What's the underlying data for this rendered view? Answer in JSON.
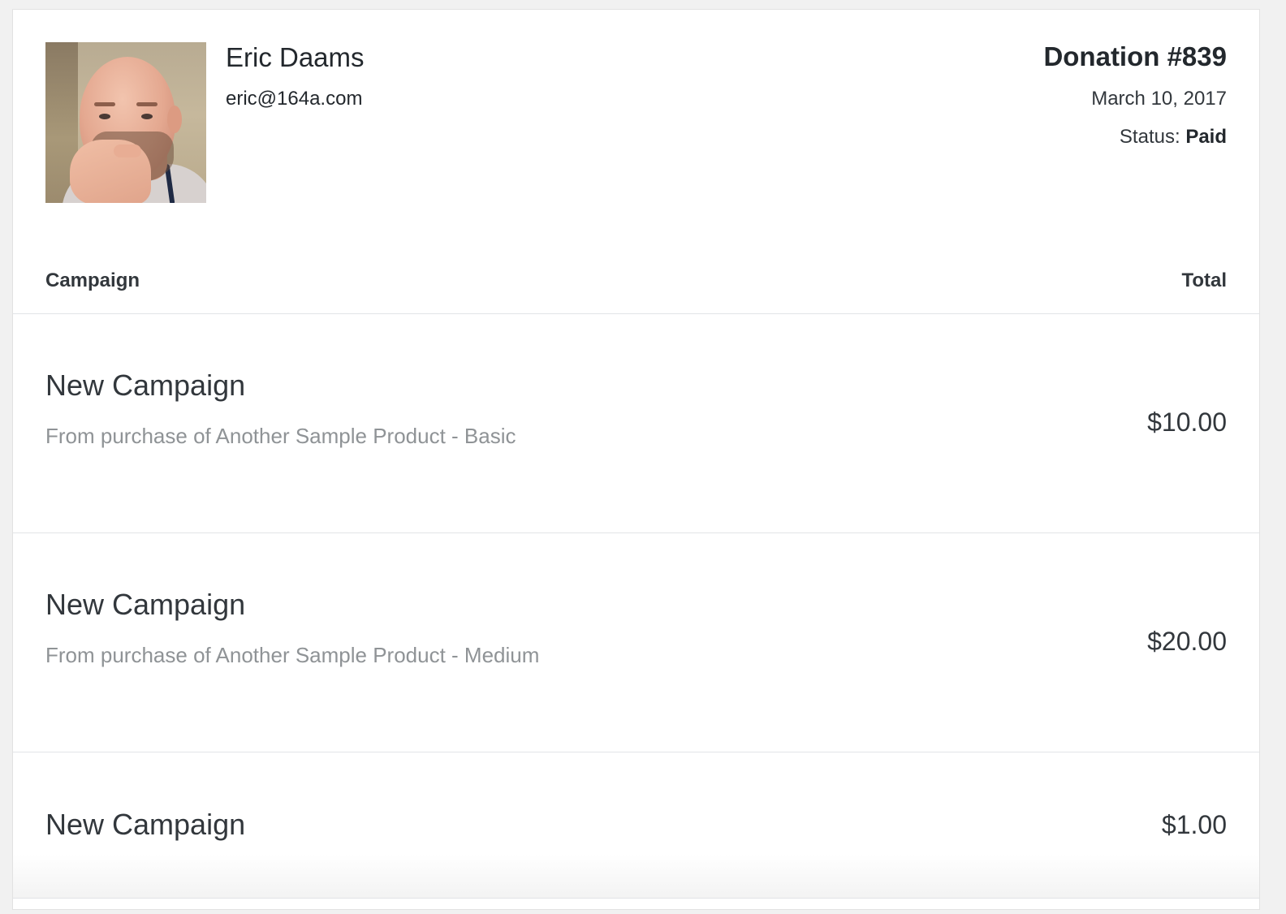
{
  "customer": {
    "name": "Eric Daams",
    "email": "eric@164a.com"
  },
  "donation": {
    "title": "Donation #839",
    "date": "March 10, 2017",
    "status_label": "Status:",
    "status_value": "Paid"
  },
  "table": {
    "headers": {
      "campaign": "Campaign",
      "total": "Total"
    },
    "rows": [
      {
        "campaign": "New Campaign",
        "detail": "From purchase of Another Sample Product - Basic",
        "amount": "$10.00"
      },
      {
        "campaign": "New Campaign",
        "detail": "From purchase of Another Sample Product - Medium",
        "amount": "$20.00"
      },
      {
        "campaign": "New Campaign",
        "amount": "$1.00"
      }
    ]
  }
}
